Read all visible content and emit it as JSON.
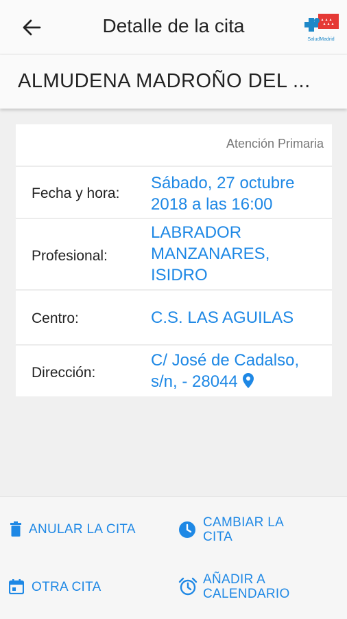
{
  "header": {
    "title": "Detalle de la cita",
    "logo_text": "SaludMadrid",
    "back_icon": "arrow-back-icon"
  },
  "patient": {
    "name": "ALMUDENA MADROÑO DEL ..."
  },
  "appointment": {
    "category": "Atención Primaria",
    "rows": [
      {
        "label": "Fecha y hora:",
        "value": "Sábado, 27 octubre 2018 a las 16:00"
      },
      {
        "label": "Profesional:",
        "value": "LABRADOR MANZANARES, ISIDRO"
      },
      {
        "label": "Centro:",
        "value": "C.S. LAS AGUILAS"
      },
      {
        "label": "Dirección:",
        "value": "C/ José de Cadalso, s/n, - 28044",
        "icon": "location-pin-icon"
      }
    ]
  },
  "actions": {
    "cancel": {
      "label": "ANULAR LA CITA",
      "icon": "trash-icon"
    },
    "change": {
      "label": "CAMBIAR LA CITA",
      "icon": "clock-icon"
    },
    "other": {
      "label": "OTRA CITA",
      "icon": "calendar-icon"
    },
    "add_calendar": {
      "label": "AÑADIR A CALENDARIO",
      "icon": "alarm-clock-icon"
    }
  },
  "colors": {
    "accent": "#1e88e5",
    "brand_red": "#e53935",
    "brand_blue": "#1e88c8"
  }
}
